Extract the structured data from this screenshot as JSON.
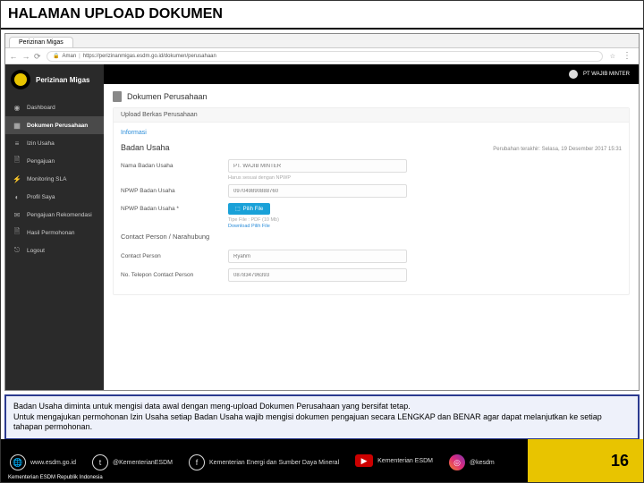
{
  "slide_title": "HALAMAN UPLOAD DOKUMEN",
  "browser": {
    "tab_label": "Perizinan Migas",
    "secure_label": "Aman",
    "url": "https://perizinanmigas.esdm.go.id/dokumen/perusahaan"
  },
  "brand": "Perizinan Migas",
  "user_label": "PT WAJIB MINTER",
  "sidebar": {
    "items": [
      {
        "icon": "◉",
        "label": "Dashboard"
      },
      {
        "icon": "▦",
        "label": "Dokumen Perusahaan"
      },
      {
        "icon": "≡",
        "label": "Izin Usaha"
      },
      {
        "icon": "🗎",
        "label": "Pengajuan"
      },
      {
        "icon": "⚡",
        "label": "Monitoring SLA"
      },
      {
        "icon": "◐",
        "label": "Profil Saya"
      },
      {
        "icon": "✉",
        "label": "Pengajuan Rekomendasi"
      },
      {
        "icon": "🗎",
        "label": "Hasil Permohonan"
      },
      {
        "icon": "⎋",
        "label": "Logout"
      }
    ]
  },
  "page": {
    "heading": "Dokumen Perusahaan",
    "card_title": "Upload Berkas Perusahaan",
    "info_link": "Informasi",
    "section": "Badan Usaha",
    "last_update": "Perubahan terakhir: Selasa, 19 Desember 2017 15:31",
    "fields": {
      "nama_label": "Nama Badan Usaha",
      "nama_value": "PT. WAJIB MINTER",
      "nama_hint": "Harus sesuai dengan NPWP",
      "npwp_label": "NPWP Badan Usaha",
      "npwp_value": "097049890888760",
      "npwp_file_label": "NPWP Badan Usaha *",
      "btn_file": "Pilih File",
      "file_hint": "Tipe File : PDF (10 Mb)",
      "file_link": "Download Pilih File"
    },
    "subsection": "Contact Person / Narahubung",
    "cp_label": "Contact Person",
    "cp_value": "Ryahm",
    "tel_label": "No. Telepon Contact Person",
    "tel_value": "087834796393"
  },
  "note": {
    "line1": "Badan Usaha diminta untuk mengisi data awal dengan meng-upload Dokumen Perusahaan yang bersifat tetap.",
    "line2": "Untuk mengajukan permohonan Izin Usaha setiap Badan Usaha wajib mengisi dokumen pengajuan secara LENGKAP dan BENAR agar dapat melanjutkan ke setiap tahapan permohonan."
  },
  "footer": {
    "items": [
      {
        "icon": "🌐",
        "label": "www.esdm.go.id"
      },
      {
        "icon": "t",
        "label": "@KementerianESDM"
      },
      {
        "icon": "f",
        "label": "Kementerian Energi dan Sumber Daya Mineral"
      },
      {
        "icon": "▶",
        "label": "Kementerian ESDM"
      },
      {
        "icon": "◎",
        "label": "@kesdm"
      }
    ],
    "page_number": "16",
    "ministry": "Kementerian ESDM Republik Indonesia"
  }
}
